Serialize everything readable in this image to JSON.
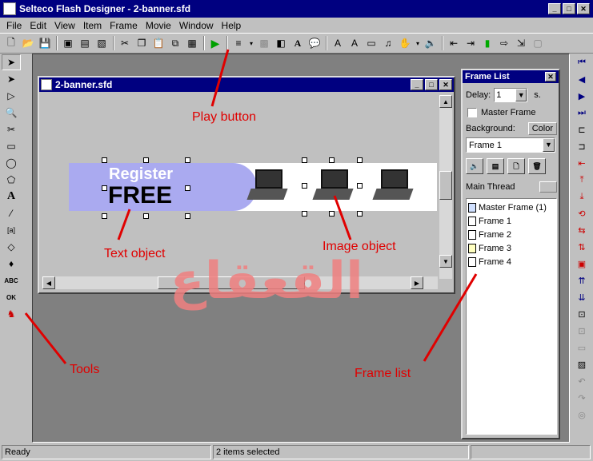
{
  "app": {
    "title": "Selteco Flash Designer - 2-banner.sfd"
  },
  "menu": [
    "File",
    "Edit",
    "View",
    "Item",
    "Frame",
    "Movie",
    "Window",
    "Help"
  ],
  "document": {
    "title": "2-banner.sfd",
    "banner": {
      "text_line1": "Register",
      "text_line2": "FREE"
    }
  },
  "frame_list": {
    "title": "Frame List",
    "delay_label": "Delay:",
    "delay_value": "1",
    "delay_unit": "s.",
    "master_frame_label": "Master Frame",
    "background_label": "Background:",
    "color_button": "Color",
    "frame_select": "Frame 1",
    "main_thread_label": "Main Thread",
    "items": [
      "Master Frame (1)",
      "Frame 1",
      "Frame 2",
      "Frame 3",
      "Frame 4"
    ]
  },
  "annotations": {
    "play_button": "Play button",
    "text_object": "Text object",
    "image_object": "Image object",
    "tools": "Tools",
    "frame_list": "Frame list"
  },
  "watermark": "القعقاع",
  "status": {
    "ready": "Ready",
    "selection": "2 items selected"
  },
  "colors": {
    "title_bar": "#000080",
    "banner_purple": "#aaaaf0",
    "annotation_red": "#e00000",
    "play_green": "#00a000"
  }
}
